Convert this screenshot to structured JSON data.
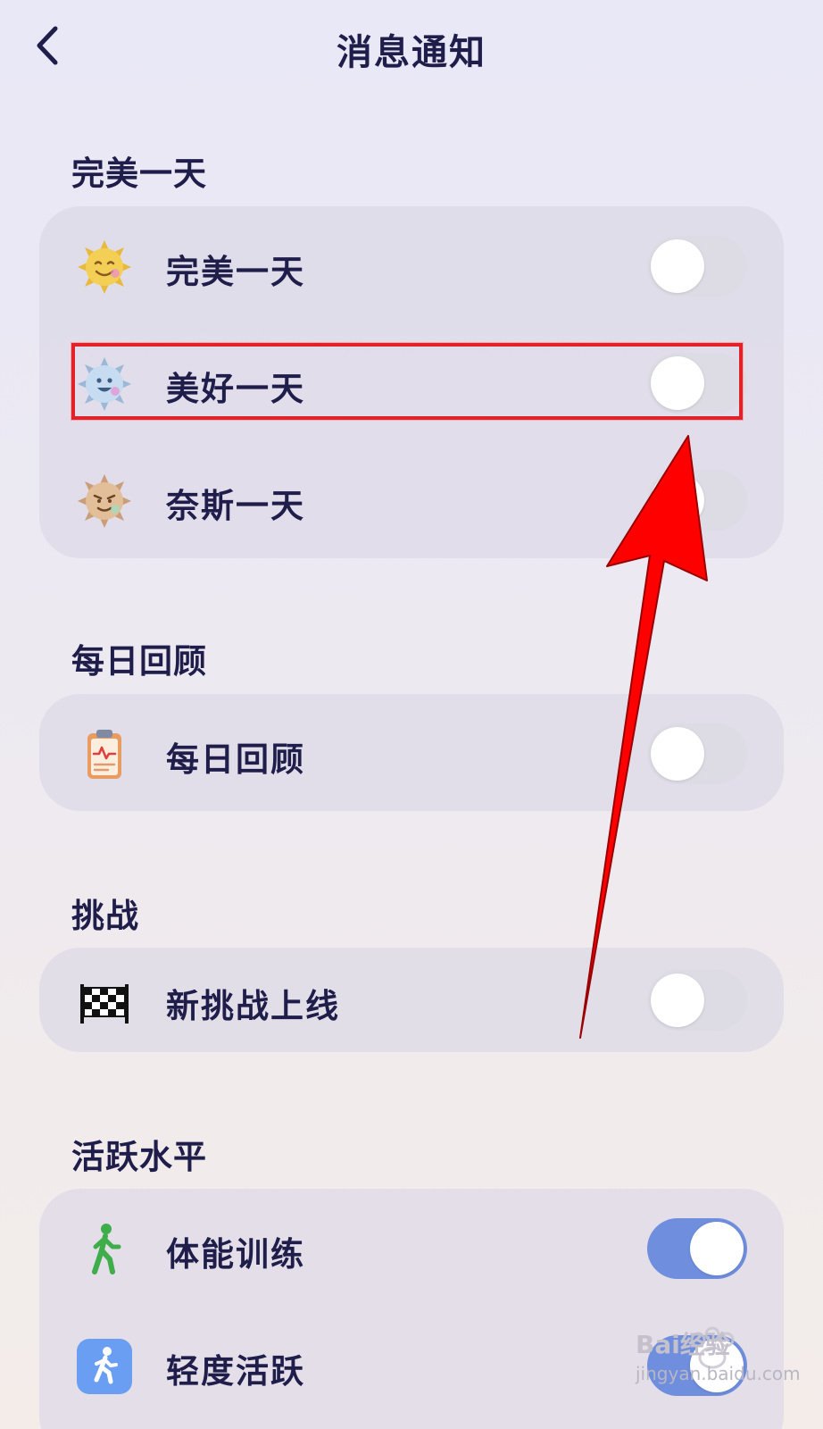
{
  "header": {
    "title": "消息通知"
  },
  "sections": [
    {
      "title": "完美一天",
      "items": [
        {
          "label": "完美一天",
          "icon": "smiling-sun-icon",
          "toggle": "off"
        },
        {
          "label": "美好一天",
          "icon": "blue-sun-icon",
          "toggle": "off"
        },
        {
          "label": "奈斯一天",
          "icon": "tan-sun-icon",
          "toggle": "off"
        }
      ]
    },
    {
      "title": "每日回顾",
      "items": [
        {
          "label": "每日回顾",
          "icon": "clipboard-icon",
          "toggle": "off"
        }
      ]
    },
    {
      "title": "挑战",
      "items": [
        {
          "label": "新挑战上线",
          "icon": "checkered-flag-icon",
          "toggle": "off"
        }
      ]
    },
    {
      "title": "活跃水平",
      "items": [
        {
          "label": "体能训练",
          "icon": "walking-person-icon",
          "toggle": "on"
        },
        {
          "label": "轻度活跃",
          "icon": "running-person-icon",
          "toggle": "on"
        }
      ]
    }
  ],
  "colors": {
    "toggle_on": "#6f8ede",
    "toggle_off": "#dddbe4",
    "annotation": "#ff0000",
    "text": "#1f1d4a"
  },
  "watermark": {
    "brand": "Bai经验",
    "domain": "jingyan.baidu.com"
  }
}
